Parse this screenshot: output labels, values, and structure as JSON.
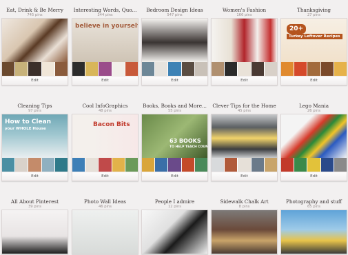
{
  "boards": [
    {
      "title": "Eat, Drink & Be Merry",
      "pins": "745 pins",
      "edit": "Edit",
      "cover_text": "",
      "cover_sub": "",
      "cover_bg": "linear-gradient(135deg,#efe8e0 0%,#d9c6b0 40%,#5a3a24 55%,#e9dfd5 75%,#8b5a3a 100%)",
      "thumbs": [
        "#6b4a2f",
        "#c7b27a",
        "#3b2f2a",
        "#f0e6d8",
        "#8a5b3c"
      ]
    },
    {
      "title": "Interesting Words, Quo...",
      "pins": "344 pins",
      "edit": "Edit",
      "cover_text": "believe in yourself",
      "cover_sub": "",
      "cover_bg": "linear-gradient(180deg,#e9e3da 0%,#cfc4b5 100%)",
      "thumbs": [
        "#2c2c2c",
        "#d8b65a",
        "#9a4c8a",
        "#f1efe9",
        "#c85a3a"
      ]
    },
    {
      "title": "Bedroom Design Ideas",
      "pins": "547 pins",
      "edit": "Edit",
      "cover_text": "",
      "cover_sub": "",
      "cover_bg": "linear-gradient(180deg,#f4f2ef 0%,#3a3432 55%,#f3f1ee 100%)",
      "thumbs": [
        "#6d8797",
        "#e6e3de",
        "#3d82b5",
        "#5a4d43",
        "#c9c1b8"
      ]
    },
    {
      "title": "Women's Fashion",
      "pins": "166 pins",
      "edit": "Edit",
      "cover_text": "",
      "cover_sub": "",
      "cover_bg": "linear-gradient(90deg,#f5f3f0 0%,#e8e1d5 30%,#b1252b 50%,#f3f0ec 70%,#c53030 90%,#f5f3f0 100%)",
      "thumbs": [
        "#b09070",
        "#2b2b2b",
        "#e9e2d8",
        "#4a3a33",
        "#d8d0c8"
      ]
    },
    {
      "title": "Thanksgiving",
      "pins": "27 pins",
      "edit": "Edit",
      "cover_text": "20+",
      "cover_sub": "Turkey Leftover Recipes",
      "cover_bg": "linear-gradient(180deg,#f7efe4 0%,#f1e1cb 100%)",
      "thumbs": [
        "#e08a2f",
        "#d54a2b",
        "#a26b3c",
        "#7b4a2a",
        "#e6b24a"
      ]
    },
    {
      "title": "Cleaning Tips",
      "pins": "97 pins",
      "edit": "Edit",
      "cover_text": "How to Clean",
      "cover_sub": "your WHOLE House",
      "cover_bg": "linear-gradient(180deg,#6fa7b5 0%,#9ec6cf 45%,#e9eef0 100%)",
      "thumbs": [
        "#4b8fa3",
        "#d9d2ca",
        "#c48b6a",
        "#8fb0c0",
        "#2f7a8a"
      ]
    },
    {
      "title": "Cool InfoGraphics",
      "pins": "48 pins",
      "edit": "Edit",
      "cover_text": "Bacon Bits",
      "cover_sub": "",
      "cover_bg": "linear-gradient(90deg,#f4f0ec 0%,#f4f0ec 30%,#f7e8e8 100%)",
      "thumbs": [
        "#3d7fb7",
        "#e6e0d8",
        "#c04a4a",
        "#e2b24a",
        "#6b9a5a"
      ]
    },
    {
      "title": "Books, Books and More...",
      "pins": "55 pins",
      "edit": "Edit",
      "cover_text": "63 BOOKS",
      "cover_sub": "TO HELP TEACH COUNTING",
      "cover_bg": "linear-gradient(135deg,#6a8a4a 0%,#9cb874 50%,#3f5a2a 100%)",
      "thumbs": [
        "#d9a53a",
        "#3a6fa8",
        "#6a4a8a",
        "#c44a2a",
        "#4a8a5a"
      ]
    },
    {
      "title": "Clever Tips for the Home",
      "pins": "45 pins",
      "edit": "Edit",
      "cover_text": "",
      "cover_sub": "",
      "cover_bg": "linear-gradient(180deg,#c7c9cb 0%,#5b5f62 30%,#f2d46a 55%,#3b3d40 80%,#c9cbcd 100%)",
      "thumbs": [
        "#d8dadc",
        "#b05a3a",
        "#e6e0d8",
        "#6a7a8a",
        "#c8a46a"
      ]
    },
    {
      "title": "Lego Mania",
      "pins": "26 pins",
      "edit": "Edit",
      "cover_text": "",
      "cover_sub": "",
      "cover_bg": "linear-gradient(135deg,#f4f4f4 0%,#f4f4f4 30%,#d63a2a 45%,#2a8a3a 55%,#f1c42a 65%,#2a5ac0 75%,#f4f4f4 100%)",
      "thumbs": [
        "#c23a2a",
        "#3a8a4a",
        "#e2c23a",
        "#2a4a8a",
        "#8a8a8a"
      ]
    },
    {
      "title": "All About Pinterest",
      "pins": "39 pins",
      "edit": "",
      "cover_text": "",
      "cover_sub": "",
      "cover_bg": "linear-gradient(180deg,#f5f3f3 0%,#e8e4e4 60%,#1d1d1d 100%)",
      "thumbs": []
    },
    {
      "title": "Photo Wall Ideas",
      "pins": "46 pins",
      "edit": "",
      "cover_text": "",
      "cover_sub": "",
      "cover_bg": "linear-gradient(180deg,#eef0ef 0%,#d8dbd9 100%)",
      "thumbs": []
    },
    {
      "title": "People I admire",
      "pins": "12 pins",
      "edit": "",
      "cover_text": "",
      "cover_sub": "",
      "cover_bg": "linear-gradient(135deg,#f8f8f8 0%,#e0e0e0 40%,#1a1a1a 60%,#f0f0f0 100%)",
      "thumbs": []
    },
    {
      "title": "Sidewalk Chalk Art",
      "pins": "8 pins",
      "edit": "",
      "cover_text": "",
      "cover_sub": "",
      "cover_bg": "linear-gradient(180deg,#7d7a78 0%,#6b4a3a 45%,#c9a46a 70%,#4a3a32 100%)",
      "thumbs": []
    },
    {
      "title": "Photography and stuff",
      "pins": "65 pins",
      "edit": "",
      "cover_text": "",
      "cover_sub": "",
      "cover_bg": "linear-gradient(180deg,#5fa3d8 0%,#9fcbe8 45%,#e8c44a 70%,#3a3a3a 100%)",
      "thumbs": []
    }
  ]
}
